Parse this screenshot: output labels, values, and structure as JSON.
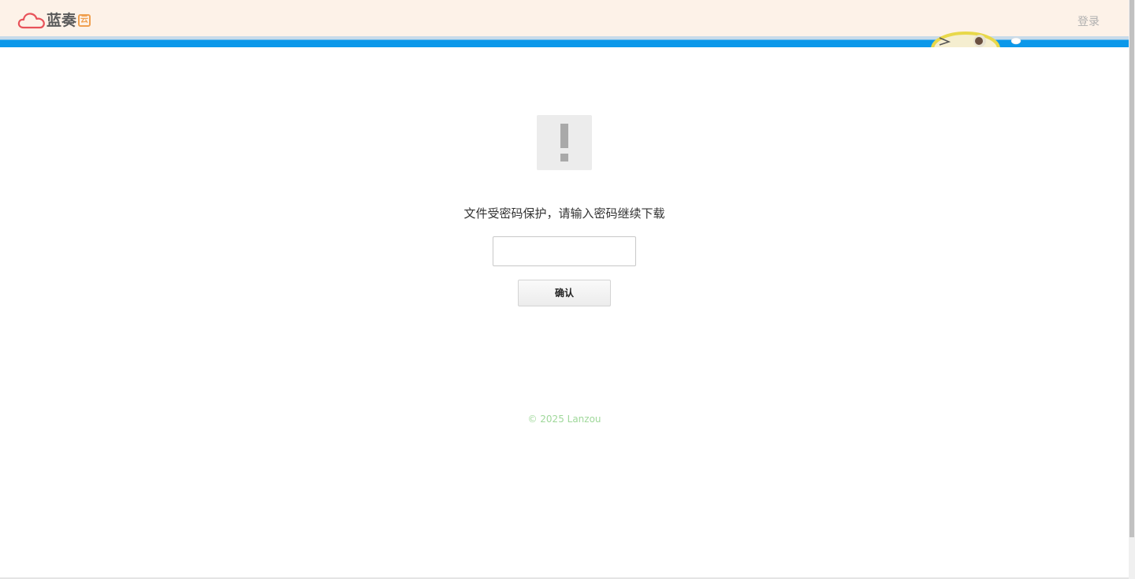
{
  "header": {
    "logo_text": "蓝奏",
    "logo_badge": "云",
    "login_label": "登录"
  },
  "main": {
    "prompt": "文件受密码保护，请输入密码继续下载",
    "password_value": "",
    "password_placeholder": "",
    "confirm_label": "确认"
  },
  "footer": {
    "copyright": "© 2025 Lanzou"
  },
  "colors": {
    "header_bg": "#fdf2e8",
    "accent_blue": "#0b98ea",
    "logo_red": "#e8535a",
    "badge_orange": "#f0a050",
    "footer_green": "#9fd89a"
  },
  "icons": {
    "logo": "cloud-icon",
    "warning": "exclamation-icon"
  }
}
